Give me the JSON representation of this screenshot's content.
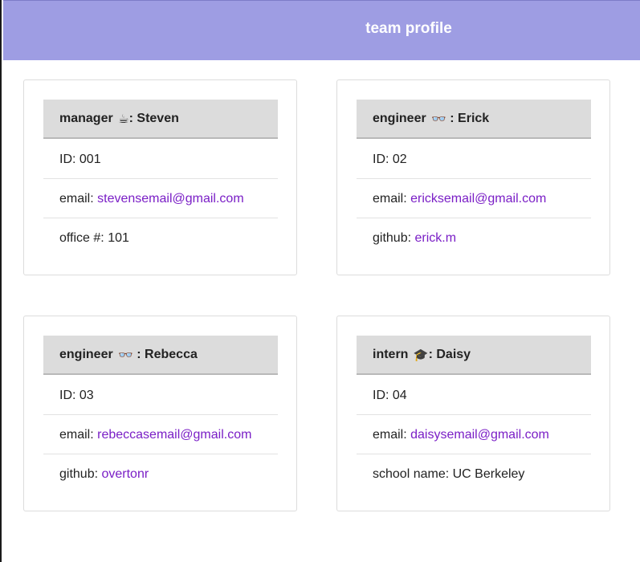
{
  "header": {
    "title": "team profile"
  },
  "colors": {
    "header_bg": "#9e9de3",
    "link": "#7a1ec6",
    "card_header_bg": "#dcdcdc"
  },
  "cards": [
    {
      "role": "manager",
      "emoji": "☕",
      "icon": "coffee-icon",
      "name": "Steven",
      "id_label": "ID: ",
      "id": "001",
      "email_label": "email: ",
      "email": "stevensemail@gmail.com",
      "extra_label": "office #: ",
      "extra_value": "101"
    },
    {
      "role": "engineer",
      "emoji": "👓",
      "icon": "glasses-icon",
      "name": "Erick",
      "id_label": "ID: ",
      "id": "02",
      "email_label": "email: ",
      "email": "ericksemail@gmail.com",
      "extra_label": "github: ",
      "extra_value": "erick.m"
    },
    {
      "role": "engineer",
      "emoji": "👓",
      "icon": "glasses-icon",
      "name": "Rebecca",
      "id_label": "ID: ",
      "id": "03",
      "email_label": "email: ",
      "email": "rebeccasemail@gmail.com",
      "extra_label": "github: ",
      "extra_value": "overtonr"
    },
    {
      "role": "intern",
      "emoji": "🎓",
      "icon": "graduation-cap-icon",
      "name": "Daisy",
      "id_label": "ID: ",
      "id": "04",
      "email_label": "email: ",
      "email": "daisysemail@gmail.com",
      "extra_label": "school name: ",
      "extra_value": "UC Berkeley"
    }
  ]
}
